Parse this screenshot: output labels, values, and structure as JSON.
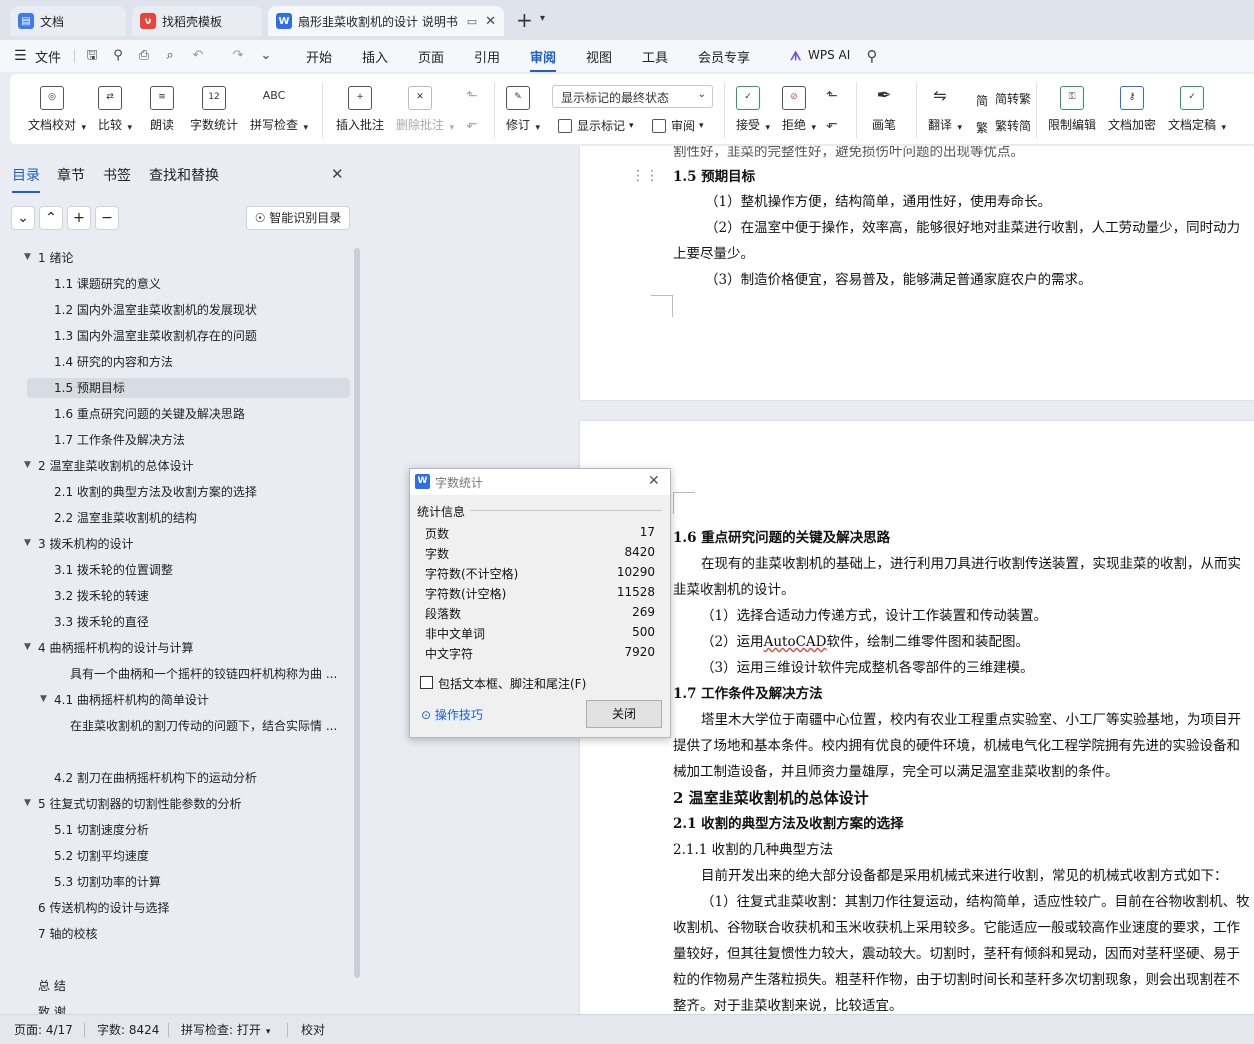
{
  "tabs": [
    {
      "label": "文档",
      "icon": "docs-app-icon",
      "color": "#3d7cf0"
    },
    {
      "label": "找稻壳模板",
      "icon": "docer-icon",
      "color": "#e8443a"
    },
    {
      "label": "扇形韭菜收割机的设计 说明书",
      "icon": "wps-writer-icon",
      "color": "#2d6ef0"
    }
  ],
  "new_tab_label": "+",
  "menu": {
    "file": "文件",
    "items": [
      "开始",
      "插入",
      "页面",
      "引用",
      "审阅",
      "视图",
      "工具",
      "会员专享"
    ],
    "selected": "审阅",
    "wps_ai": "WPS AI"
  },
  "ribbon": {
    "doc_check": "文档校对",
    "compare": "比较",
    "read_aloud": "朗读",
    "word_count": "字数统计",
    "spell_check": "拼写检查",
    "insert_comment": "插入批注",
    "delete_comment": "删除批注",
    "revise": "修订",
    "markup_state": "显示标记的最终状态",
    "show_markup": "显示标记",
    "review": "审阅",
    "accept": "接受",
    "reject": "拒绝",
    "pen": "画笔",
    "translate": "翻译",
    "to_traditional": "简转繁",
    "to_simplified": "繁转简",
    "restrict_edit": "限制编辑",
    "encrypt": "文档加密",
    "finalize": "文档定稿",
    "abc_label": "ABC",
    "num_label": "12"
  },
  "nav": {
    "tabs": [
      "目录",
      "章节",
      "书签",
      "查找和替换"
    ],
    "selected_tab": "目录",
    "smart_btn": "智能识别目录",
    "toc": [
      {
        "label": "1 绪论",
        "level": 1,
        "expanded": true
      },
      {
        "label": "1.1 课题研究的意义",
        "level": 2
      },
      {
        "label": "1.2 国内外温室韭菜收割机的发展现状",
        "level": 2
      },
      {
        "label": "1.3 国内外温室韭菜收割机存在的问题",
        "level": 2
      },
      {
        "label": "1.4 研究的内容和方法",
        "level": 2
      },
      {
        "label": "1.5 预期目标",
        "level": 2,
        "selected": true
      },
      {
        "label": "1.6 重点研究问题的关键及解决思路",
        "level": 2
      },
      {
        "label": "1.7 工作条件及解决方法",
        "level": 2
      },
      {
        "label": "2 温室韭菜收割机的总体设计",
        "level": 1,
        "expanded": true
      },
      {
        "label": "2.1 收割的典型方法及收割方案的选择",
        "level": 2
      },
      {
        "label": "2.2 温室韭菜收割机的结构",
        "level": 2
      },
      {
        "label": "3 拨禾机构的设计",
        "level": 1,
        "expanded": true
      },
      {
        "label": "3.1 拨禾轮的位置调整",
        "level": 2
      },
      {
        "label": "3.2 拨禾轮的转速",
        "level": 2
      },
      {
        "label": "3.3  拨禾轮的直径",
        "level": 2
      },
      {
        "label": "4 曲柄摇杆机构的设计与计算",
        "level": 1,
        "expanded": true
      },
      {
        "label": "具有一个曲柄和一个摇杆的铰链四杆机构称为曲 ...",
        "level": 3
      },
      {
        "label": "4.1 曲柄摇杆机构的简单设计",
        "level": 2,
        "expanded": true
      },
      {
        "label": "在韭菜收割机的割刀传动的问题下，结合实际情 ...",
        "level": 3
      },
      {
        "label": "4.2 割刀在曲柄摇杆机构下的运动分析",
        "level": 2
      },
      {
        "label": "5 往复式切割器的切割性能参数的分析",
        "level": 1,
        "expanded": true
      },
      {
        "label": "5.1 切割速度分析",
        "level": 2
      },
      {
        "label": "5.2 切割平均速度",
        "level": 2
      },
      {
        "label": "5.3 切割功率的计算",
        "level": 2
      },
      {
        "label": "6 传送机构的设计与选择",
        "level": 1
      },
      {
        "label": "7  轴的校核",
        "level": 1
      },
      {
        "label": "总 结",
        "level": 1
      },
      {
        "label": "致 谢",
        "level": 1
      }
    ]
  },
  "doc": {
    "p1": "割性好，韭菜的完整性好，避免损伤叶问题的出现等优点。",
    "h15": "1.5 预期目标",
    "p2": "（1）整机操作方便，结构简单，通用性好，使用寿命长。",
    "p3a": "（2）在温室中便于操作，效率高，能够很好地对韭菜进行收割，人工劳动量少，同时动力",
    "p3b": "上要尽量少。",
    "p4": "（3）制造价格便宜，容易普及，能够满足普通家庭农户的需求。",
    "h16": "1.6 重点研究问题的关键及解决思路",
    "p5a": "在现有的韭菜收割机的基础上，进行利用刀具进行收割传送装置，实现韭菜的收割，从而实",
    "p5b": "韭菜收割机的设计。",
    "p6": "（1）选择合适动力传递方式，设计工作装置和传动装置。",
    "p7_pre": "（2）运用",
    "p7_auto": "AutoCAD",
    "p7_post": "软件，绘制二维零件图和装配图。",
    "p8": "（3）运用三维设计软件完成整机各零部件的三维建模。",
    "h17": "1.7 工作条件及解决方法",
    "p9a": "塔里木大学位于南疆中心位置，校内有农业工程重点实验室、小工厂等实验基地，为项目开",
    "p9b": "提供了场地和基本条件。校内拥有优良的硬件环境，机械电气化工程学院拥有先进的实验设备和",
    "p9c": "械加工制造设备，并且师资力量雄厚，完全可以满足温室韭菜收割的条件。",
    "h2": "2 温室韭菜收割机的总体设计",
    "h21": "2.1 收割的典型方法及收割方案的选择",
    "h211": "2.1.1 收割的几种典型方法",
    "p10": "目前开发出来的绝大部分设备都是采用机械式来进行收割，常见的机械式收割方式如下：",
    "p11a": "（1）往复式韭菜收割：其割刀作往复运动，结构简单，适应性较广。目前在谷物收割机、牧",
    "p11b": "收割机、谷物联合收获机和玉米收获机上采用较多。它能适应一般或较高作业速度的要求，工作",
    "p11c": "量较好，但其往复惯性力较大，震动较大。切割时，茎秆有倾斜和晃动，因而对茎秆坚硬、易于",
    "p11d": "粒的作物易产生落粒损失。粗茎秆作物，由于切割时间长和茎秆多次切割现象，则会出现割茬不",
    "p11e": "整齐。对于韭菜收割来说，比较适宜。"
  },
  "dialog": {
    "title": "字数统计",
    "section": "统计信息",
    "rows": [
      {
        "label": "页数",
        "value": "17"
      },
      {
        "label": "字数",
        "value": "8420"
      },
      {
        "label": "字符数(不计空格)",
        "value": "10290"
      },
      {
        "label": "字符数(计空格)",
        "value": "11528"
      },
      {
        "label": "段落数",
        "value": "269"
      },
      {
        "label": "非中文单词",
        "value": "500"
      },
      {
        "label": "中文字符",
        "value": "7920"
      }
    ],
    "checkbox": "包括文本框、脚注和尾注(F)",
    "tips": "操作技巧",
    "close": "关闭"
  },
  "status": {
    "page": "页面: 4/17",
    "words": "字数: 8424",
    "spell": "拼写检查: 打开",
    "proof": "校对"
  },
  "colors": {
    "accent": "#1a5fd6",
    "wps_red": "#e8443a"
  }
}
